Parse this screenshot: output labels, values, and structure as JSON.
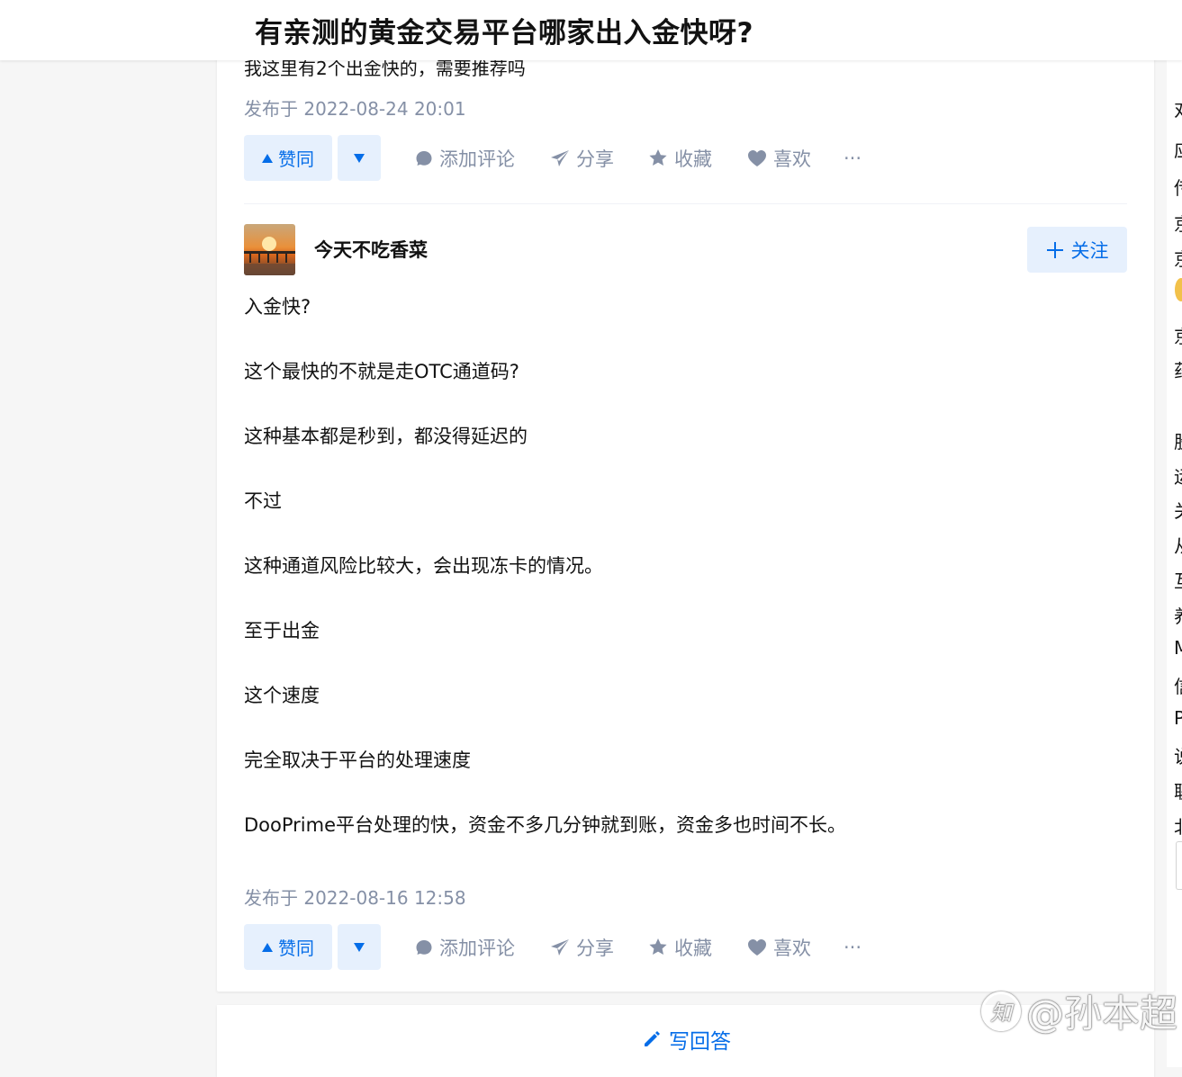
{
  "question": {
    "title": "有亲测的黄金交易平台哪家出入金快呀?"
  },
  "previous_answer": {
    "text": "我这里有2个出金快的，需要推荐吗",
    "published": "发布于 2022-08-24 20:01",
    "actions": {
      "upvote": "赞同",
      "comment": "添加评论",
      "share": "分享",
      "collect": "收藏",
      "like": "喜欢",
      "more": "···"
    }
  },
  "answer": {
    "author": "今天不吃香菜",
    "follow_label": "关注",
    "paragraphs": [
      "入金快?",
      "这个最快的不就是走OTC通道码?",
      "这种基本都是秒到，都没得延迟的",
      "不过",
      "这种通道风险比较大，会出现冻卡的情况。",
      "至于出金",
      "这个速度",
      "完全取决于平台的处理速度",
      "DooPrime平台处理的快，资金不多几分钟就到账，资金多也时间不长。"
    ],
    "published": "发布于 2022-08-16 12:58",
    "actions": {
      "upvote": "赞同",
      "comment": "添加评论",
      "share": "分享",
      "collect": "收藏",
      "like": "喜欢",
      "more": "···"
    }
  },
  "write_answer": {
    "label": "写回答"
  },
  "sidebar_chars": [
    "对",
    "应",
    "传",
    "京",
    "京",
    "京",
    "药",
    "股",
    "运",
    "关",
    "从",
    "互",
    "养",
    "M",
    "信",
    "P",
    "说",
    "联",
    "北"
  ],
  "watermark": "@孙本超",
  "colors": {
    "accent": "#056de8",
    "accent_bg": "#e6f0fd",
    "muted": "#8590a6"
  }
}
